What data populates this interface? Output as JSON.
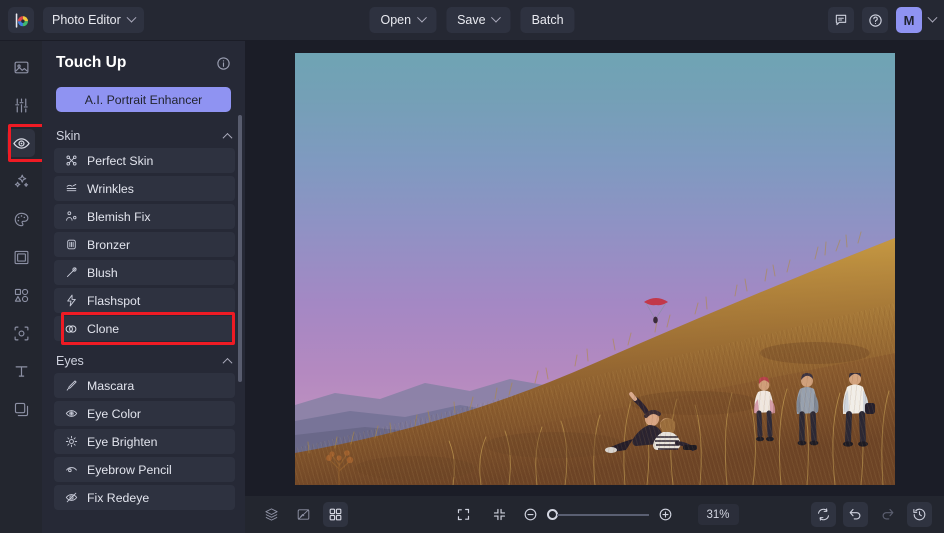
{
  "app": {
    "logo_icon": "color-wheel-logo",
    "menu_label": "Photo Editor"
  },
  "topbar": {
    "open_label": "Open",
    "save_label": "Save",
    "batch_label": "Batch",
    "feedback_icon": "chat-bubble-icon",
    "help_icon": "help-circle-icon",
    "avatar_initial": "M"
  },
  "rail": {
    "items": [
      {
        "name": "image-icon",
        "label": "Image"
      },
      {
        "name": "adjust-sliders-icon",
        "label": "Adjust"
      },
      {
        "name": "eye-touchup-icon",
        "label": "Touch Up",
        "selected": true,
        "highlighted": true
      },
      {
        "name": "sparkles-effects-icon",
        "label": "Effects"
      },
      {
        "name": "palette-icon",
        "label": "Color"
      },
      {
        "name": "frame-icon",
        "label": "Frames"
      },
      {
        "name": "shapes-icon",
        "label": "Shapes"
      },
      {
        "name": "crop-transform-icon",
        "label": "Crop"
      },
      {
        "name": "text-icon",
        "label": "Text"
      },
      {
        "name": "layers-icon",
        "label": "Layers"
      }
    ]
  },
  "panel": {
    "title": "Touch Up",
    "info_icon": "info-circle-icon",
    "ai_button_label": "A.I. Portrait Enhancer",
    "accent_color": "#8f93f2",
    "highlight_color": "#ef1b24",
    "sections": [
      {
        "title": "Skin",
        "collapse_icon": "chevron-up-icon",
        "items": [
          {
            "label": "Perfect Skin",
            "icon": "perfect-skin-icon"
          },
          {
            "label": "Wrinkles",
            "icon": "wrinkles-icon"
          },
          {
            "label": "Blemish Fix",
            "icon": "blemish-fix-icon"
          },
          {
            "label": "Bronzer",
            "icon": "bronzer-icon"
          },
          {
            "label": "Blush",
            "icon": "blush-brush-icon"
          },
          {
            "label": "Flashspot",
            "icon": "flashspot-bolt-icon"
          },
          {
            "label": "Clone",
            "icon": "clone-icon",
            "highlighted": true
          }
        ]
      },
      {
        "title": "Eyes",
        "collapse_icon": "chevron-up-icon",
        "items": [
          {
            "label": "Mascara",
            "icon": "mascara-wand-icon"
          },
          {
            "label": "Eye Color",
            "icon": "eye-color-icon"
          },
          {
            "label": "Eye Brighten",
            "icon": "eye-brighten-icon"
          },
          {
            "label": "Eyebrow Pencil",
            "icon": "eyebrow-pencil-icon"
          },
          {
            "label": "Fix Redeye",
            "icon": "fix-redeye-icon"
          }
        ]
      }
    ]
  },
  "canvas": {
    "photo_description": "Sunset hillside with golden grass, people on a ridge and a paraglider in a teal-to-purple sky"
  },
  "bottombar": {
    "left_icons": [
      {
        "name": "layers-stack-icon",
        "active": false
      },
      {
        "name": "compare-split-icon",
        "active": false
      },
      {
        "name": "grid-view-icon",
        "active": true
      }
    ],
    "fit_screen_icon": "fit-to-screen-icon",
    "actual_size_icon": "actual-size-icon",
    "zoom_out_icon": "zoom-out-icon",
    "zoom_in_icon": "zoom-in-icon",
    "zoom_level": "31%",
    "right_icons": [
      {
        "name": "reset-icon",
        "active": true
      },
      {
        "name": "undo-icon",
        "active": true
      },
      {
        "name": "redo-icon",
        "active": false
      },
      {
        "name": "history-icon",
        "active": true
      }
    ]
  }
}
